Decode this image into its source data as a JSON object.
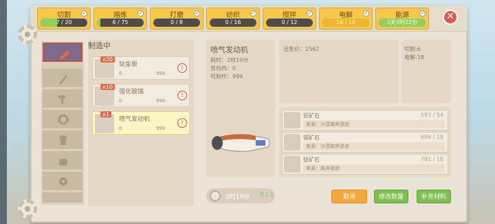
{
  "tabs": [
    {
      "label": "切割",
      "value": "7 / 20",
      "progress": 0.35
    },
    {
      "label": "熔炼",
      "value": "6 / 75",
      "progress": 0.08
    },
    {
      "label": "打磨",
      "value": "0 / 8",
      "progress": 0
    },
    {
      "label": "纺织",
      "value": "0 / 16",
      "progress": 0
    },
    {
      "label": "搅拌",
      "value": "0 / 12",
      "progress": 0
    },
    {
      "label": "电解",
      "value": "18 / 10",
      "progress": 1
    },
    {
      "label": "能源",
      "value": "2天4时22分",
      "progress": 1
    }
  ],
  "queue": {
    "title": "制造中",
    "items": [
      {
        "count": "x30",
        "name": "钛金板",
        "a": "0",
        "b": "999"
      },
      {
        "count": "x10",
        "name": "强化玻璃",
        "a": "0",
        "b": "999"
      },
      {
        "count": "x1",
        "name": "喷气发动机",
        "a": "0",
        "b": "999"
      }
    ]
  },
  "detail": {
    "name": "喷气发动机",
    "time": "耗时：2时19分",
    "stock": "背包内：0",
    "craftable": "可制作：999"
  },
  "info": {
    "price": "出售价：2562",
    "cut": "切割:6",
    "elec": "电解:18"
  },
  "materials": [
    {
      "name": "铝矿石",
      "count": "593 / 54",
      "source": "来源：沙漠废弃遗迹"
    },
    {
      "name": "锡矿石",
      "count": "686 / 18",
      "source": "来源：沙漠废弃遗迹"
    },
    {
      "name": "钴矿石",
      "count": "781 / 18",
      "source": "来源：废弃遗迹"
    }
  ],
  "timer": {
    "time": "2时19分",
    "count": "0 / 1"
  },
  "buttons": {
    "cancel": "取消",
    "modify": "修改数量",
    "supply": "补充材料"
  }
}
